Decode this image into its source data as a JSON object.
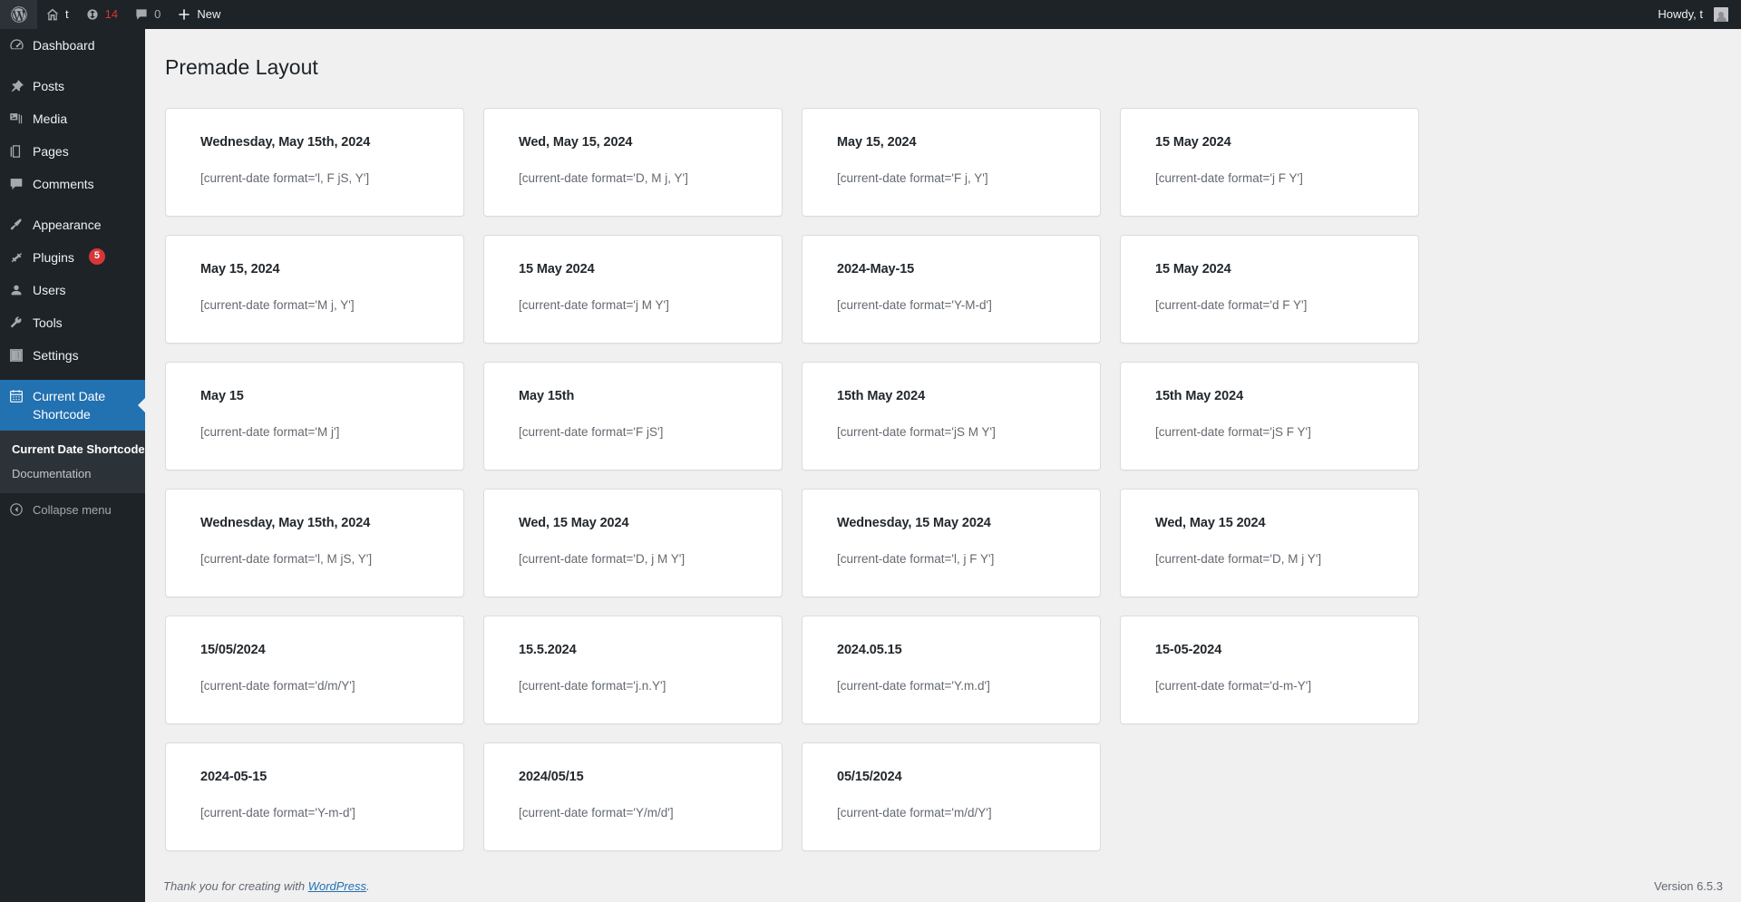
{
  "adminbar": {
    "logo_icon": "wordpress-logo-icon",
    "site_name": "t",
    "site_icon": "home-icon",
    "updates_icon": "updates-icon",
    "updates_count": "14",
    "comments_icon": "comment-bubble-icon",
    "comments_count": "0",
    "new_icon": "plus-icon",
    "new_label": "New",
    "howdy_label": "Howdy, t",
    "avatar": "avatar-icon"
  },
  "sidebar": {
    "items": [
      {
        "label": "Dashboard",
        "icon": "dashboard-icon",
        "key": "dashboard"
      },
      {
        "label": "Posts",
        "icon": "pin-icon",
        "key": "posts"
      },
      {
        "label": "Media",
        "icon": "media-icon",
        "key": "media"
      },
      {
        "label": "Pages",
        "icon": "pages-icon",
        "key": "pages"
      },
      {
        "label": "Comments",
        "icon": "comment-bubble-icon",
        "key": "comments"
      },
      {
        "label": "Appearance",
        "icon": "paintbrush-icon",
        "key": "appearance"
      },
      {
        "label": "Plugins",
        "icon": "plug-icon",
        "key": "plugins",
        "badge": "5"
      },
      {
        "label": "Users",
        "icon": "user-icon",
        "key": "users"
      },
      {
        "label": "Tools",
        "icon": "wrench-icon",
        "key": "tools"
      },
      {
        "label": "Settings",
        "icon": "sliders-icon",
        "key": "settings"
      },
      {
        "label": "Current Date Shortcode",
        "icon": "calendar-icon",
        "key": "current-date-shortcode",
        "current": true
      }
    ],
    "submenu": [
      {
        "label": "Current Date Shortcode",
        "current": true
      },
      {
        "label": "Documentation",
        "current": false
      }
    ],
    "collapse_label": "Collapse menu",
    "collapse_icon": "collapse-arrow-icon",
    "accent_color": "#2271b1",
    "badge_color": "#d63638"
  },
  "main": {
    "page_title": "Premade Layout",
    "cards": [
      {
        "date": "Wednesday, May 15th, 2024",
        "code": "[current-date format='l, F jS, Y']"
      },
      {
        "date": "Wed, May 15, 2024",
        "code": "[current-date format='D, M j, Y']"
      },
      {
        "date": "May 15, 2024",
        "code": "[current-date format='F j, Y']"
      },
      {
        "date": "15 May 2024",
        "code": "[current-date format='j F Y']"
      },
      {
        "date": "May 15, 2024",
        "code": "[current-date format='M j, Y']"
      },
      {
        "date": "15 May 2024",
        "code": "[current-date format='j M Y']"
      },
      {
        "date": "2024-May-15",
        "code": "[current-date format='Y-M-d']"
      },
      {
        "date": "15 May 2024",
        "code": "[current-date format='d F Y']"
      },
      {
        "date": "May 15",
        "code": "[current-date format='M j']"
      },
      {
        "date": "May 15th",
        "code": "[current-date format='F jS']"
      },
      {
        "date": "15th May 2024",
        "code": "[current-date format='jS M Y']"
      },
      {
        "date": "15th May 2024",
        "code": "[current-date format='jS F Y']"
      },
      {
        "date": "Wednesday, May 15th, 2024",
        "code": "[current-date format='l, M jS, Y']"
      },
      {
        "date": "Wed, 15 May 2024",
        "code": "[current-date format='D, j M Y']"
      },
      {
        "date": "Wednesday, 15 May 2024",
        "code": "[current-date format='l, j F Y']"
      },
      {
        "date": "Wed, May 15 2024",
        "code": "[current-date format='D, M j Y']"
      },
      {
        "date": "15/05/2024",
        "code": "[current-date format='d/m/Y']"
      },
      {
        "date": "15.5.2024",
        "code": "[current-date format='j.n.Y']"
      },
      {
        "date": "2024.05.15",
        "code": "[current-date format='Y.m.d']"
      },
      {
        "date": "15-05-2024",
        "code": "[current-date format='d-m-Y']"
      },
      {
        "date": "2024-05-15",
        "code": "[current-date format='Y-m-d']"
      },
      {
        "date": "2024/05/15",
        "code": "[current-date format='Y/m/d']"
      },
      {
        "date": "05/15/2024",
        "code": "[current-date format='m/d/Y']"
      }
    ]
  },
  "footer": {
    "thanks_prefix": "Thank you for creating with ",
    "wordpress_link": "WordPress",
    "thanks_suffix": ".",
    "version": "Version 6.5.3"
  }
}
